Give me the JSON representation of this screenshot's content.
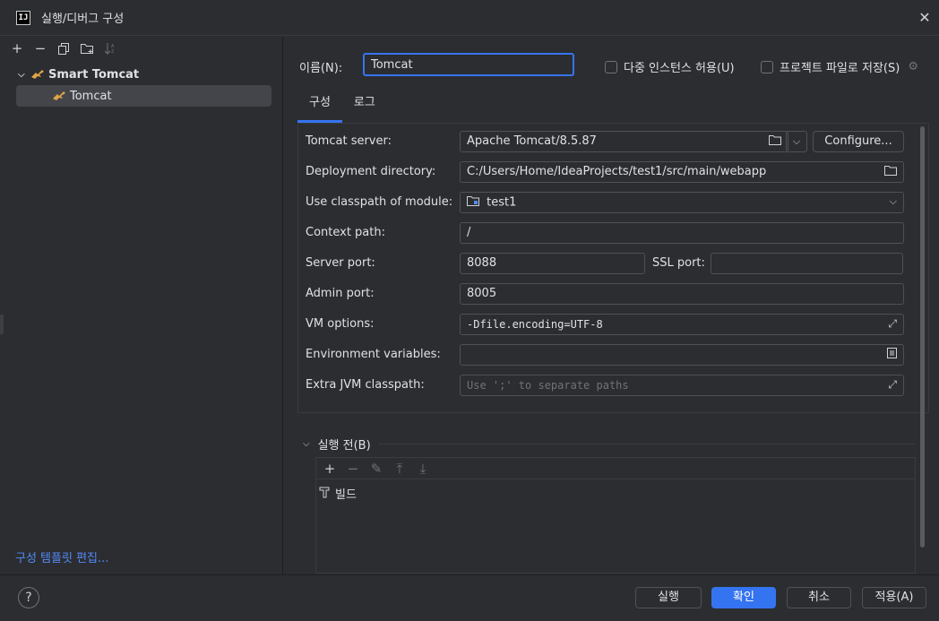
{
  "window": {
    "title": "실행/디버그 구성",
    "app_icon_text": "IJ"
  },
  "left_panel": {
    "tree": {
      "group_label": "Smart Tomcat",
      "item_label": "Tomcat"
    },
    "edit_templates_link": "구성 템플릿 편집..."
  },
  "header": {
    "name_label": "이름(N):",
    "name_value": "Tomcat",
    "allow_multiple_label": "다중 인스턴스 허용(U)",
    "store_project_label": "프로젝트 파일로 저장(S)"
  },
  "tabs": [
    {
      "label": "구성",
      "active": true
    },
    {
      "label": "로그",
      "active": false
    }
  ],
  "fields": {
    "tomcat_server": {
      "label": "Tomcat server:",
      "value": "Apache Tomcat/8.5.87",
      "configure_label": "Configure..."
    },
    "deployment_dir": {
      "label": "Deployment directory:",
      "value": "C:/Users/Home/IdeaProjects/test1/src/main/webapp"
    },
    "classpath_module": {
      "label": "Use classpath of module:",
      "value": "test1"
    },
    "context_path": {
      "label": "Context path:",
      "value": "/"
    },
    "server_port": {
      "label": "Server port:",
      "value": "8088"
    },
    "ssl_port": {
      "label": "SSL port:",
      "value": ""
    },
    "admin_port": {
      "label": "Admin port:",
      "value": "8005"
    },
    "vm_options": {
      "label": "VM options:",
      "value": "-Dfile.encoding=UTF-8"
    },
    "env_vars": {
      "label": "Environment variables:",
      "value": ""
    },
    "extra_classpath": {
      "label": "Extra JVM classpath:",
      "placeholder": "Use ';' to separate paths"
    }
  },
  "before_launch": {
    "label": "실행 전(B)",
    "items": [
      {
        "label": "빌드",
        "icon": "hammer-icon"
      }
    ]
  },
  "footer": {
    "help": "?",
    "run_label": "실행",
    "ok_label": "확인",
    "cancel_label": "취소",
    "apply_label": "적용(A)"
  },
  "colors": {
    "accent": "#3574f0",
    "background": "#2b2d30",
    "link": "#548af7"
  }
}
